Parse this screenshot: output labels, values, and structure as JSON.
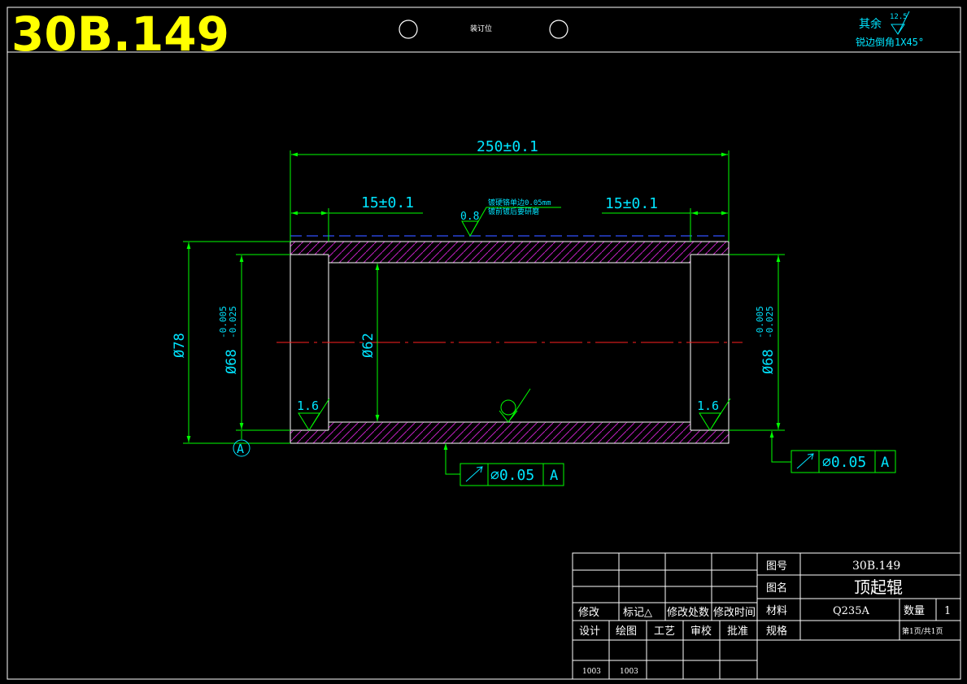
{
  "drawing_number_large": "30B.149",
  "binding_label": "装订位",
  "surface_note": {
    "prefix": "其余",
    "roughness": "12.5",
    "chamfer": "锐边倒角1X45°"
  },
  "dimensions": {
    "overall_length": "250±0.1",
    "left_shoulder": "15±0.1",
    "right_shoulder": "15±0.1",
    "outer_dia": "Ø78",
    "bearing_dia": "Ø68",
    "bearing_tol_upper": "-0.005",
    "bearing_tol_lower": "-0.025",
    "bore_dia": "Ø62",
    "surface_roughness_top": "0.8",
    "roughness_left": "1.6",
    "roughness_right": "1.6",
    "plating_note_1": "镀硬铬单边0.05mm",
    "plating_note_2": "镀前镀后要研磨",
    "datum_label": "A"
  },
  "tolerance_frames": [
    {
      "symbol": "runout",
      "value": "∅0.05",
      "datum": "A"
    },
    {
      "symbol": "runout",
      "value": "∅0.05",
      "datum": "A"
    }
  ],
  "title_block": {
    "revision_headers": [
      "修改",
      "标记△",
      "修改处数",
      "修改时间"
    ],
    "role_headers": [
      "设计",
      "绘图",
      "工艺",
      "审校",
      "批准"
    ],
    "dates": [
      "1003",
      "1003"
    ],
    "drawing_no_label": "图号",
    "drawing_no_value": "30B.149",
    "name_label": "图名",
    "name_value": "顶起辊",
    "material_label": "材料",
    "material_value": "Q235A",
    "qty_label": "数量",
    "qty_value": "1",
    "spec_label": "规格",
    "sheet_info": "第1页/共1页"
  }
}
